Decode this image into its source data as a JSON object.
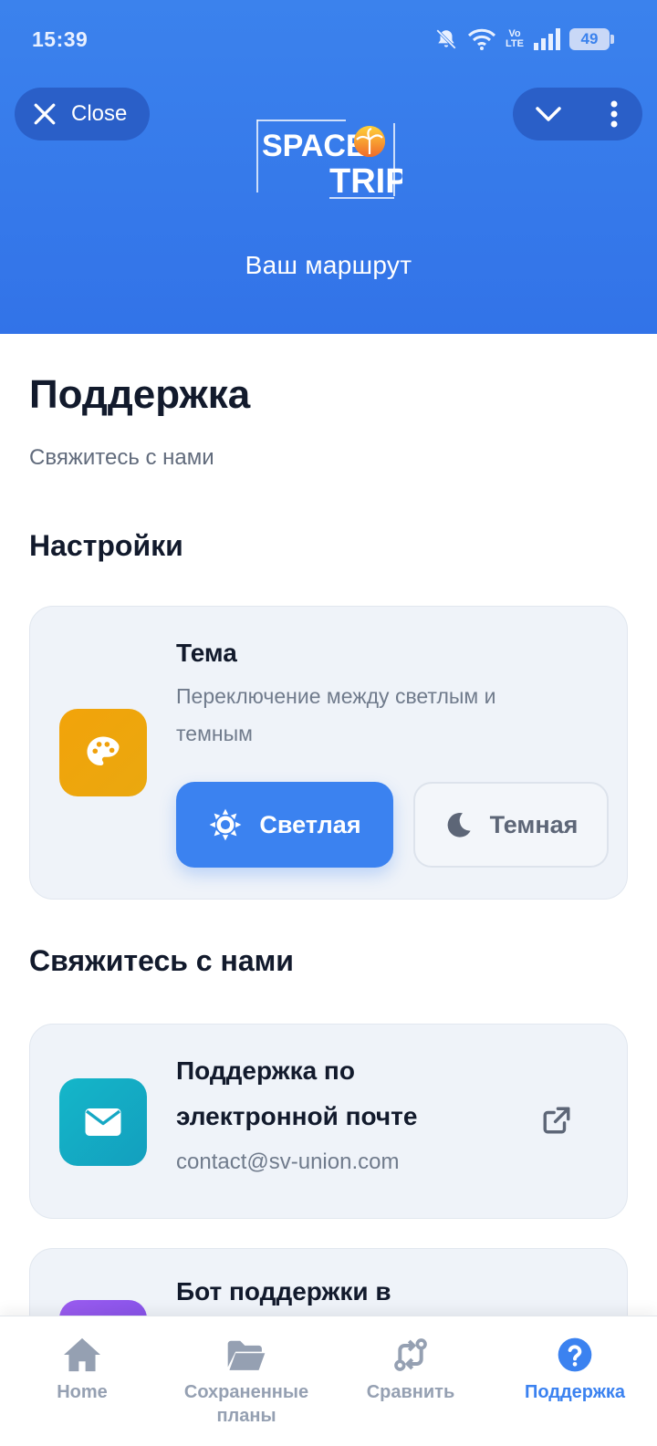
{
  "status_bar": {
    "time": "15:39",
    "network_badge_top": "Vo",
    "network_badge_bottom": "LTE",
    "battery": "49"
  },
  "header": {
    "close_label": "Close",
    "logo_line1": "SPACE",
    "logo_line2": "TRIP",
    "title": "Ваш маршрут"
  },
  "page": {
    "title": "Поддержка",
    "subtitle": "Свяжитесь с нами"
  },
  "settings": {
    "section_title": "Настройки",
    "theme_card": {
      "title": "Тема",
      "desc_line1": "Переключение между светлым и",
      "desc_line2": "темным",
      "light_label": "Светлая",
      "dark_label": "Темная"
    }
  },
  "contact": {
    "section_title": "Свяжитесь с нами",
    "email_card": {
      "title_line1": "Поддержка по",
      "title_line2": "электронной почте",
      "email": "contact@sv-union.com"
    },
    "bot_card": {
      "title_line1": "Бот поддержки в"
    }
  },
  "bottom_nav": {
    "items": [
      {
        "label": "Home",
        "icon": "home-icon"
      },
      {
        "label": "Сохраненные\nпланы",
        "icon": "folder-icon"
      },
      {
        "label": "Сравнить",
        "icon": "compare-icon"
      },
      {
        "label": "Поддержка",
        "icon": "help-circle-icon"
      }
    ],
    "active_index": 3
  },
  "colors": {
    "header_bg": "#3b82ed",
    "accent": "#3b82f0",
    "theme_tile": "#f0a10c",
    "email_tile": "#16a8c4",
    "bot_tile": "#8b54e8"
  }
}
